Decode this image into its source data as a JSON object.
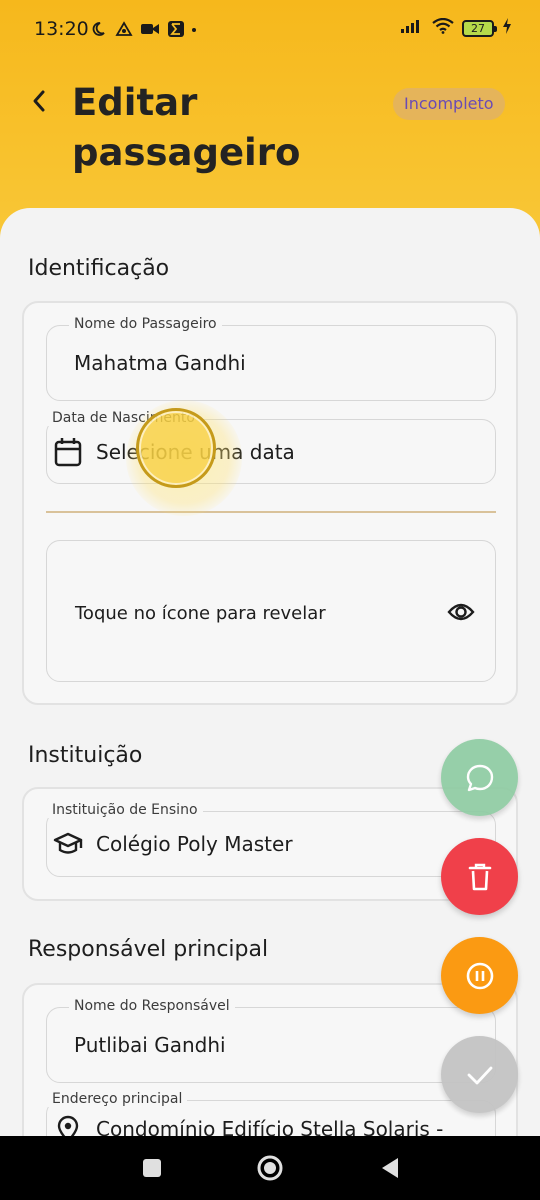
{
  "status_bar": {
    "time": "13:20",
    "battery": "27"
  },
  "header": {
    "title": "Editar passageiro",
    "status_chip": "Incompleto"
  },
  "identificacao": {
    "title": "Identificação",
    "nome_label": "Nome do Passageiro",
    "nome_value": "Mahatma Gandhi",
    "nascimento_label": "Data de Nascimento",
    "nascimento_value": "Selecione uma data",
    "reveal_text": "Toque no ícone para revelar"
  },
  "instituicao": {
    "title": "Instituição",
    "label": "Instituição de Ensino",
    "value": "Colégio Poly Master"
  },
  "responsavel": {
    "title": "Responsável principal",
    "nome_label": "Nome do Responsável",
    "nome_value": "Putlibai Gandhi",
    "endereco_label": "Endereço principal",
    "endereco_value": "Condomínio Edifício Stella Solaris -"
  },
  "fabs": {
    "chat_color": "#8fcca3",
    "delete_color": "#f0404a",
    "pause_color": "#fb9a12",
    "confirm_color": "#c4c4c4"
  },
  "icons": [
    "back-arrow-icon",
    "calendar-icon",
    "eye-icon",
    "graduation-cap-icon",
    "location-pin-icon",
    "chat-bubble-icon",
    "trash-icon",
    "pause-icon",
    "check-icon"
  ]
}
